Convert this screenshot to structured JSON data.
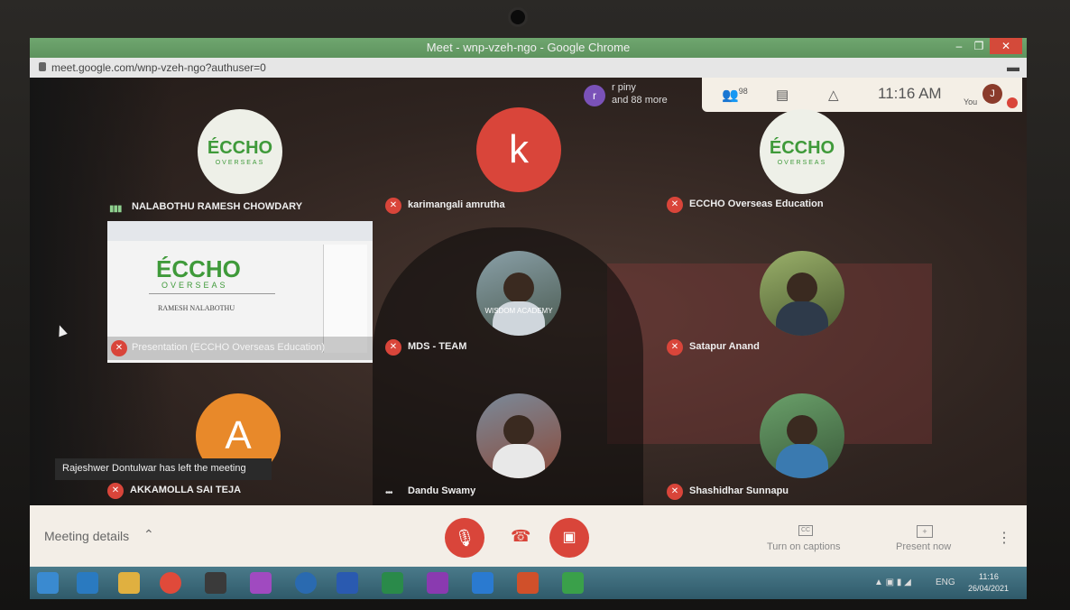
{
  "window": {
    "title": "Meet - wnp-vzeh-ngo - Google Chrome",
    "url": "meet.google.com/wnp-vzeh-ngo?authuser=0",
    "minimize": "–",
    "maximize": "❐",
    "close": "✕"
  },
  "top_panel": {
    "participants_count": "98",
    "time": "11:16 AM",
    "you_label": "You",
    "you_initial": "J"
  },
  "more_participants": {
    "initial": "r",
    "line1": "r piny",
    "line2": "and 88 more"
  },
  "tiles": [
    {
      "name": "NALABOTHU RAMESH CHOWDARY",
      "avatar_type": "logo",
      "logo_main": "ÉCCHO",
      "logo_sub": "OVERSEAS",
      "mic": "on"
    },
    {
      "name": "karimangali amrutha",
      "avatar_type": "letter",
      "initial": "k",
      "color": "#d9453a",
      "mic": "off"
    },
    {
      "name": "ECCHO Overseas Education",
      "avatar_type": "logo",
      "logo_main": "ÉCCHO",
      "logo_sub": "OVERSEAS",
      "mic": "off"
    },
    {
      "name": "MDS - TEAM",
      "avatar_type": "photo",
      "caption": "WISDOM ACADEMY",
      "mic": "off"
    },
    {
      "name": "Satapur Anand",
      "avatar_type": "photo",
      "mic": "off"
    },
    {
      "name": "AKKAMOLLA SAI TEJA",
      "avatar_type": "letter",
      "initial": "A",
      "color": "#e8892a",
      "mic": "off"
    },
    {
      "name": "Dandu Swamy",
      "avatar_type": "photo",
      "mic": "speaking"
    },
    {
      "name": "Shashidhar Sunnapu",
      "avatar_type": "photo",
      "mic": "off"
    }
  ],
  "presentation": {
    "label": "Presentation (ECCHO Overseas Education)",
    "logo_main": "ÉCCHO",
    "logo_sub": "OVERSEAS",
    "person": "RAMESH NALABOTHU"
  },
  "toast": "Rajeshwer Dontulwar has left the meeting",
  "bottom_bar": {
    "meeting_details": "Meeting details",
    "captions": "Turn on captions",
    "present": "Present now"
  },
  "taskbar": {
    "tray_lang": "ENG",
    "clock_time": "11:16",
    "clock_date": "26/04/2021"
  },
  "colors": {
    "meet_red": "#d9453a",
    "eccho_green": "#3f9a3a",
    "titlebar_green": "#5e935e"
  }
}
